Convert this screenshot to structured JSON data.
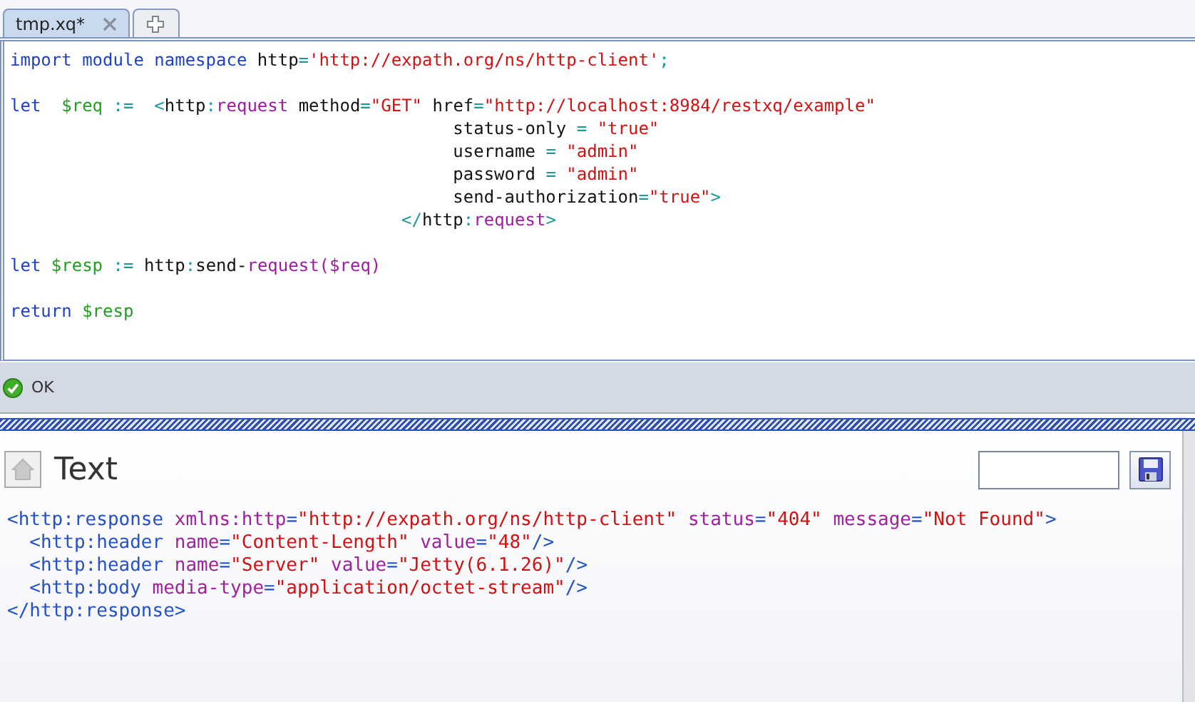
{
  "tabs": [
    {
      "kind": "file",
      "label": "tmp.xq*",
      "selected": true
    },
    {
      "kind": "add",
      "selected": false
    }
  ],
  "editor": {
    "blocks": [
      [
        [
          {
            "kind": "keyword",
            "text": "import module namespace "
          },
          {
            "kind": "plain",
            "text": "http"
          },
          {
            "kind": "op",
            "text": "="
          },
          {
            "kind": "string",
            "text": "'http://expath.org/ns/http-client'"
          },
          {
            "kind": "op",
            "text": ";"
          }
        ]
      ],
      [
        [
          {
            "kind": "keyword",
            "text": "let  "
          },
          {
            "kind": "variable",
            "text": "$req "
          },
          {
            "kind": "op",
            "text": ":=  <"
          },
          {
            "kind": "plain",
            "text": "http"
          },
          {
            "kind": "op",
            "text": ":"
          },
          {
            "kind": "element",
            "text": "request"
          },
          {
            "kind": "plain",
            "text": " method"
          },
          {
            "kind": "op",
            "text": "="
          },
          {
            "kind": "string",
            "text": "\"GET\""
          },
          {
            "kind": "plain",
            "text": " href"
          },
          {
            "kind": "op",
            "text": "="
          },
          {
            "kind": "string",
            "text": "\"http://localhost:8984/restxq/example\""
          }
        ],
        [
          {
            "kind": "plain",
            "text": "                                           status-only "
          },
          {
            "kind": "op",
            "text": "= "
          },
          {
            "kind": "string",
            "text": "\"true\""
          }
        ],
        [
          {
            "kind": "plain",
            "text": "                                           username "
          },
          {
            "kind": "op",
            "text": "= "
          },
          {
            "kind": "string",
            "text": "\"admin\""
          }
        ],
        [
          {
            "kind": "plain",
            "text": "                                           password "
          },
          {
            "kind": "op",
            "text": "= "
          },
          {
            "kind": "string",
            "text": "\"admin\""
          }
        ],
        [
          {
            "kind": "plain",
            "text": "                                           send-authorization"
          },
          {
            "kind": "op",
            "text": "="
          },
          {
            "kind": "string",
            "text": "\"true\""
          },
          {
            "kind": "op",
            "text": ">"
          }
        ],
        [
          {
            "kind": "op",
            "text": "                                      </"
          },
          {
            "kind": "plain",
            "text": "http"
          },
          {
            "kind": "op",
            "text": ":"
          },
          {
            "kind": "element",
            "text": "request"
          },
          {
            "kind": "op",
            "text": ">"
          }
        ]
      ],
      [
        [
          {
            "kind": "keyword",
            "text": "let "
          },
          {
            "kind": "variable",
            "text": "$resp "
          },
          {
            "kind": "op",
            "text": ":= "
          },
          {
            "kind": "plain",
            "text": "http"
          },
          {
            "kind": "op",
            "text": ":"
          },
          {
            "kind": "plain",
            "text": "send-"
          },
          {
            "kind": "element",
            "text": "request($req)"
          }
        ]
      ],
      [
        [
          {
            "kind": "keyword",
            "text": "return "
          },
          {
            "kind": "variable",
            "text": "$resp"
          }
        ]
      ]
    ]
  },
  "status": {
    "success": true,
    "message": "OK"
  },
  "result": {
    "title": "Text",
    "lines": [
      [
        {
          "kind": "tag",
          "text": "<http:response "
        },
        {
          "kind": "attr",
          "text": "xmlns:http"
        },
        {
          "kind": "punct",
          "text": "="
        },
        {
          "kind": "string",
          "text": "\"http://expath.org/ns/http-client\""
        },
        {
          "kind": "attr",
          "text": " status"
        },
        {
          "kind": "punct",
          "text": "="
        },
        {
          "kind": "string",
          "text": "\"404\""
        },
        {
          "kind": "attr",
          "text": " message"
        },
        {
          "kind": "punct",
          "text": "="
        },
        {
          "kind": "string",
          "text": "\"Not Found\""
        },
        {
          "kind": "tag",
          "text": ">"
        }
      ],
      [
        {
          "kind": "tag",
          "text": "  <http:header "
        },
        {
          "kind": "attr",
          "text": "name"
        },
        {
          "kind": "punct",
          "text": "="
        },
        {
          "kind": "string",
          "text": "\"Content-Length\""
        },
        {
          "kind": "attr",
          "text": " value"
        },
        {
          "kind": "punct",
          "text": "="
        },
        {
          "kind": "string",
          "text": "\"48\""
        },
        {
          "kind": "tag",
          "text": "/>"
        }
      ],
      [
        {
          "kind": "tag",
          "text": "  <http:header "
        },
        {
          "kind": "attr",
          "text": "name"
        },
        {
          "kind": "punct",
          "text": "="
        },
        {
          "kind": "string",
          "text": "\"Server\""
        },
        {
          "kind": "attr",
          "text": " value"
        },
        {
          "kind": "punct",
          "text": "="
        },
        {
          "kind": "string",
          "text": "\"Jetty(6.1.26)\""
        },
        {
          "kind": "tag",
          "text": "/>"
        }
      ],
      [
        {
          "kind": "tag",
          "text": "  <http:body "
        },
        {
          "kind": "attr",
          "text": "media-type"
        },
        {
          "kind": "punct",
          "text": "="
        },
        {
          "kind": "string",
          "text": "\"application/octet-stream\""
        },
        {
          "kind": "tag",
          "text": "/>"
        }
      ],
      [
        {
          "kind": "tag",
          "text": "</http:response>"
        }
      ]
    ]
  }
}
